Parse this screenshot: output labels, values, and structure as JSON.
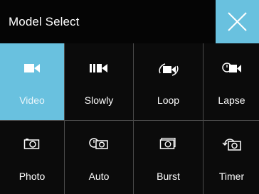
{
  "header": {
    "title": "Model Select"
  },
  "modes": [
    {
      "label": "Video",
      "icon": "video-camera-icon",
      "selected": true
    },
    {
      "label": "Slowly",
      "icon": "slow-motion-icon",
      "selected": false
    },
    {
      "label": "Loop",
      "icon": "loop-record-icon",
      "selected": false
    },
    {
      "label": "Lapse",
      "icon": "time-lapse-icon",
      "selected": false
    },
    {
      "label": "Photo",
      "icon": "photo-camera-icon",
      "selected": false
    },
    {
      "label": "Auto",
      "icon": "auto-capture-icon",
      "selected": false
    },
    {
      "label": "Burst",
      "icon": "burst-shot-icon",
      "selected": false
    },
    {
      "label": "Timer",
      "icon": "self-timer-icon",
      "selected": false
    }
  ],
  "colors": {
    "accent": "#69c1df",
    "background": "#0b0b0b",
    "divider": "#4a4a4a"
  }
}
